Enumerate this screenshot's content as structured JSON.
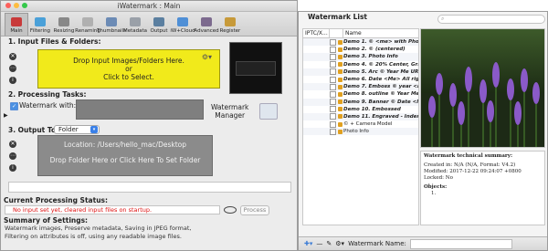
{
  "main": {
    "title": "iWatermark : Main",
    "toolbar": [
      {
        "label": "Main",
        "icon": "stamp-icon",
        "color": "#c83a3a",
        "active": true
      },
      {
        "label": "Filtering",
        "icon": "filter-icon",
        "color": "#4aa0d8"
      },
      {
        "label": "Resizing",
        "icon": "resize-icon",
        "color": "#888888"
      },
      {
        "label": "Renaming",
        "icon": "rename-icon",
        "color": "#b0b0b0"
      },
      {
        "label": "Thumbnails",
        "icon": "thumbnails-icon",
        "color": "#6c8bb5"
      },
      {
        "label": "Metadata",
        "icon": "metadata-icon",
        "color": "#9aa0a8"
      },
      {
        "label": "Output",
        "icon": "output-icon",
        "color": "#5b7fa0"
      },
      {
        "label": "iW+Cloud",
        "icon": "cloud-icon",
        "color": "#4f8fd6"
      },
      {
        "label": "Advanced",
        "icon": "advanced-gear-icon",
        "color": "#7c6a8e"
      },
      {
        "label": "Register",
        "icon": "register-key-icon",
        "color": "#c79a3a"
      }
    ],
    "input": {
      "heading": "1. Input Files & Folders:",
      "drop_line1": "Drop Input Images/Folders Here.",
      "drop_line2": "or",
      "drop_line3": "Click to Select."
    },
    "tasks": {
      "heading": "2. Processing Tasks:",
      "watermark_with": "Watermark with:",
      "watermark_manager_line1": "Watermark",
      "watermark_manager_line2": "Manager"
    },
    "output": {
      "heading": "3. Output To:",
      "select_value": "Folder",
      "location": "Location: /Users/hello_mac/Desktop",
      "drop_text": "Drop Folder Here or Click Here To Set Folder"
    },
    "status": {
      "heading": "Current Processing Status:",
      "message": "No input set yet, cleared input files on startup.",
      "process_label": "Process"
    },
    "summary": {
      "heading": "Summary of Settings:",
      "line1": "Watermark images, Preserve metadata, Saving in JPEG format,",
      "line2": "Filtering on attributes is off, using any readable image files."
    }
  },
  "list": {
    "title": "Watermark List",
    "columns": [
      "IPTC/X...",
      "",
      "Name"
    ],
    "rows": [
      "Demo 1. © <me> with Photo Info b",
      "Demo 2. © (centered)",
      "Demo 3. Photo Info",
      "Demo 4. © 20% Center, Graphic, O",
      "Demo 5. Arc © Year Me URL",
      "Demo 6. Date <Me> All rights res",
      "Demo 7. Emboss © year <me> Cen",
      "Demo 8. outline © Year Me URL Ce",
      "Demo 9. Banner © Date <Me> All r",
      "Demo 10. Embossed",
      "Demo 11. Engraved - Indented",
      "© + Camera Model",
      "Photo Info"
    ],
    "tech_summary": {
      "heading": "Watermark technical summary:",
      "created": "Created in: N/A (N/A, Format: V4.2)",
      "modified": "Modified: 2017-12-22 09:24:07 +0800",
      "locked": "Locked: No",
      "objects_heading": "Objects:",
      "objects_item": "1."
    },
    "bottom": {
      "name_label": "Watermark Name:"
    }
  }
}
